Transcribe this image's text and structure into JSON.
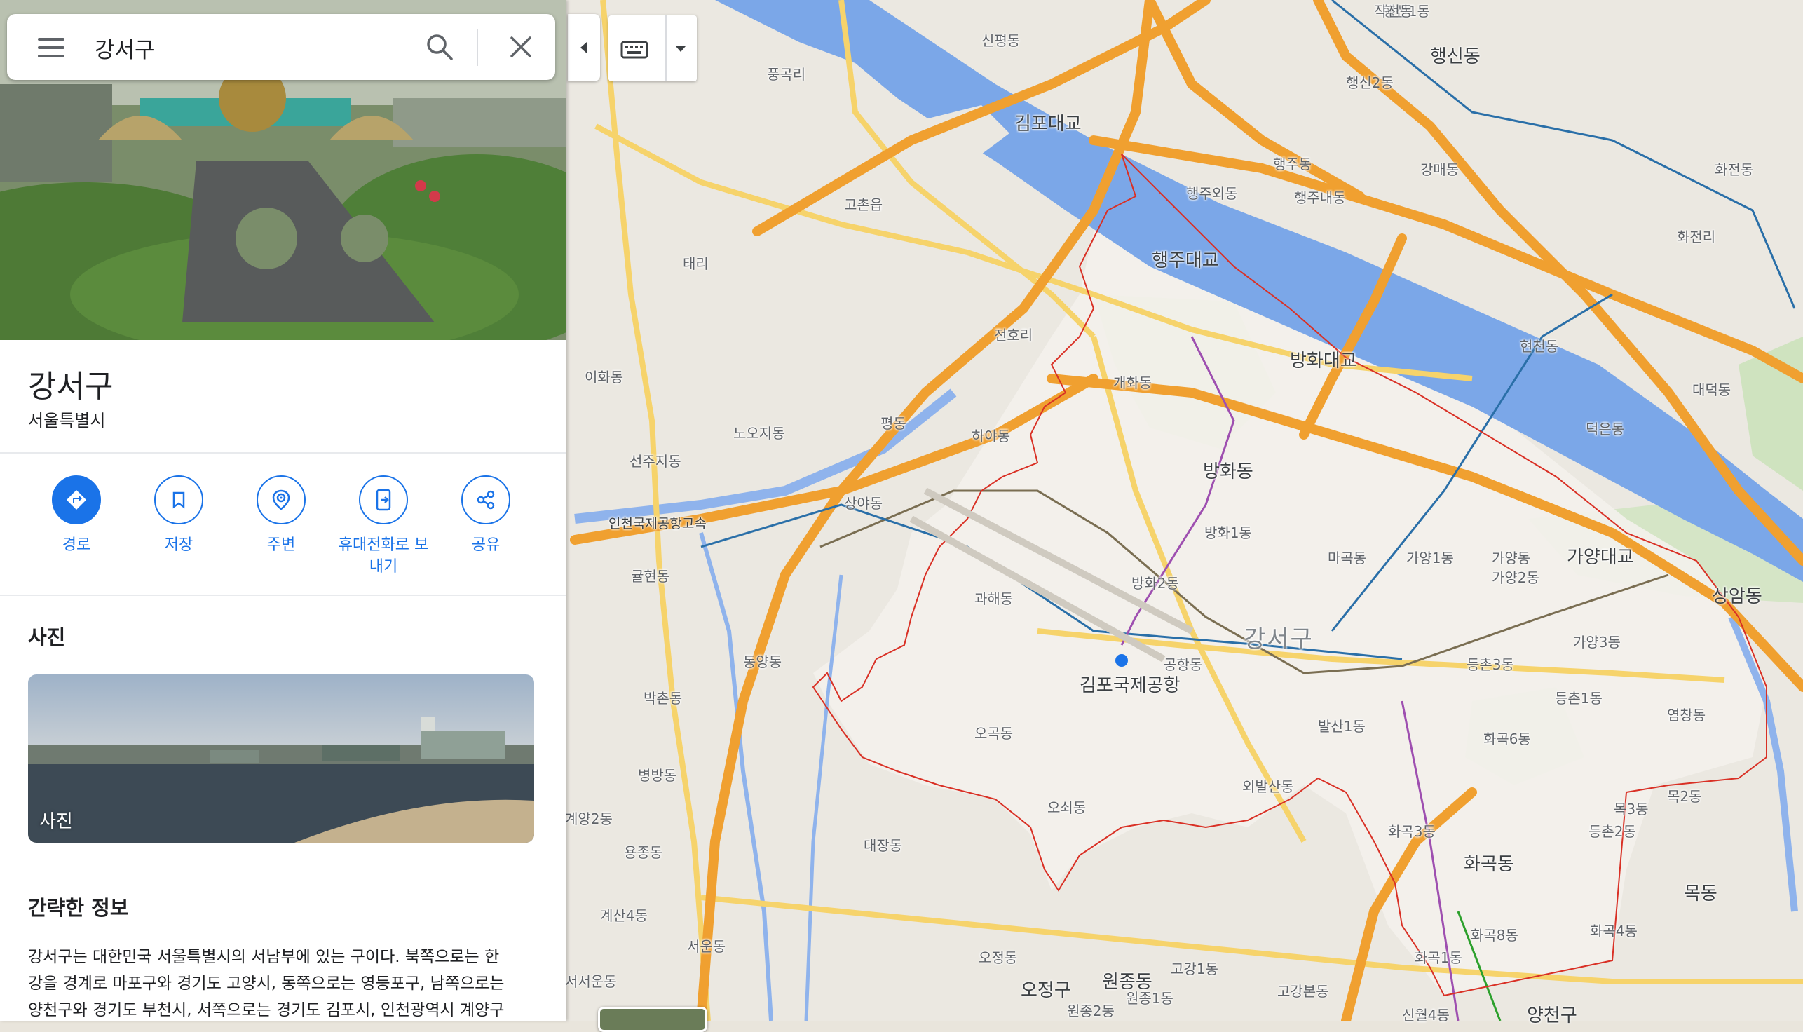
{
  "search": {
    "query": "강서구"
  },
  "place": {
    "title": "강서구",
    "subtitle": "서울특별시"
  },
  "actions": [
    {
      "label": "경로",
      "icon": "directions-icon"
    },
    {
      "label": "저장",
      "icon": "bookmark-icon"
    },
    {
      "label": "주변",
      "icon": "nearby-icon"
    },
    {
      "label": "휴대전화로 보내기",
      "label_line1": "휴대전화로 보",
      "label_line2": "내기",
      "icon": "send-to-phone-icon"
    },
    {
      "label": "공유",
      "icon": "share-icon"
    }
  ],
  "photos": {
    "heading": "사진",
    "card_label": "사진"
  },
  "about": {
    "heading": "간략한 정보",
    "lines": [
      "강서구는 대한민국 서울특별시의 서남부에 있는 구이다. 북쪽으로는 한",
      "강을 경계로 마포구와 경기도 고양시, 동쪽으로는 영등포구, 남쪽으로는",
      "양천구와 경기도 부천시, 서쪽으로는 경기도 김포시, 인천광역시 계양구"
    ]
  },
  "colors": {
    "accent": "#1a73e8",
    "river": "#7ba7e8",
    "highway": "#f0a030",
    "boundary": "#d93025"
  },
  "map_labels": {
    "district_main": "강서구",
    "airport": "김포국제공항",
    "bridges": [
      "김포대교",
      "행주대교",
      "방화대교",
      "가양대교"
    ],
    "expressway": "인천국제공항고속",
    "neighborhoods": [
      "신평동",
      "풍곡리",
      "행신동",
      "행신2동",
      "행신1동",
      "행주동",
      "행주외동",
      "행주내동",
      "강매동",
      "화전동",
      "고촌읍",
      "태리",
      "전호리",
      "현천동",
      "대덕동",
      "덕은동",
      "이화동",
      "개화동",
      "방화동",
      "방화1동",
      "방화2동",
      "노오지동",
      "평동",
      "하야동",
      "선주지동",
      "상야동",
      "마곡동",
      "가양1동",
      "가양동",
      "가양2동",
      "상암동",
      "귤현동",
      "과해동",
      "강서구",
      "공항동",
      "등촌3동",
      "가양3동",
      "동양동",
      "박촌동",
      "오곡동",
      "발산1동",
      "화곡6동",
      "등촌1동",
      "염창동",
      "병방동",
      "외발산동",
      "목3동",
      "목2동",
      "오쇠동",
      "화곡3동",
      "등촌2동",
      "용종동",
      "대장동",
      "화곡동",
      "목동",
      "계산4동",
      "화곡8동",
      "화곡4동",
      "서운동",
      "오정동",
      "화곡1동",
      "고강1동",
      "원종동",
      "오정구",
      "고강본동",
      "원종1동",
      "원종2동",
      "신월4동",
      "양천구",
      "서서운동",
      "작전동",
      "계양2동",
      "화전리"
    ]
  }
}
